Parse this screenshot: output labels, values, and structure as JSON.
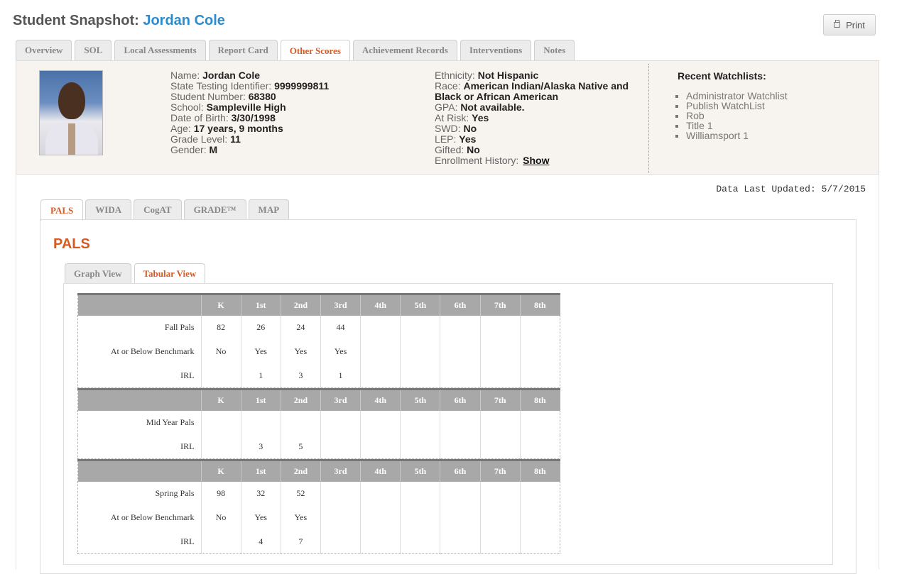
{
  "header": {
    "title_prefix": "Student Snapshot:",
    "student_name": "Jordan Cole",
    "print_label": "Print"
  },
  "main_tabs": [
    {
      "label": "Overview"
    },
    {
      "label": "SOL"
    },
    {
      "label": "Local Assessments"
    },
    {
      "label": "Report Card"
    },
    {
      "label": "Other Scores",
      "active": true
    },
    {
      "label": "Achievement Records"
    },
    {
      "label": "Interventions"
    },
    {
      "label": "Notes"
    }
  ],
  "student": {
    "left": [
      {
        "label": "Name:",
        "value": "Jordan Cole"
      },
      {
        "label": "State Testing Identifier:",
        "value": "9999999811"
      },
      {
        "label": "Student Number:",
        "value": "68380"
      },
      {
        "label": "School:",
        "value": "Sampleville High"
      },
      {
        "label": "Date of Birth:",
        "value": "3/30/1998"
      },
      {
        "label": "Age:",
        "value": "17 years, 9 months"
      },
      {
        "label": "Grade Level:",
        "value": "11"
      },
      {
        "label": "Gender:",
        "value": "M"
      }
    ],
    "right": [
      {
        "label": "Ethnicity:",
        "value": "Not Hispanic"
      },
      {
        "label": "Race:",
        "value": "American Indian/Alaska Native and Black or African American"
      },
      {
        "label": "GPA:",
        "value": "Not available."
      },
      {
        "label": "At Risk:",
        "value": "Yes"
      },
      {
        "label": "SWD:",
        "value": "No"
      },
      {
        "label": "LEP:",
        "value": "Yes"
      },
      {
        "label": "Gifted:",
        "value": "No"
      }
    ],
    "enrollment_label": "Enrollment History:",
    "enrollment_link": "Show"
  },
  "watchlists": {
    "title": "Recent Watchlists:",
    "items": [
      "Administrator Watchlist",
      "Publish WatchList",
      "Rob",
      "Title 1",
      "Williamsport 1"
    ]
  },
  "data_updated": "Data Last Updated: 5/7/2015",
  "score_tabs": [
    {
      "label": "PALS",
      "active": true
    },
    {
      "label": "WIDA"
    },
    {
      "label": "CogAT"
    },
    {
      "label": "GRADE™"
    },
    {
      "label": "MAP"
    }
  ],
  "pals": {
    "title": "PALS",
    "view_tabs": [
      {
        "label": "Graph View"
      },
      {
        "label": "Tabular View",
        "active": true
      }
    ],
    "grades": [
      "K",
      "1st",
      "2nd",
      "3rd",
      "4th",
      "5th",
      "6th",
      "7th",
      "8th"
    ],
    "tables": [
      {
        "id": "t-fall",
        "rows": [
          {
            "label": "Fall Pals",
            "cells": [
              "82",
              "26",
              "24",
              "44",
              "",
              "",
              "",
              "",
              ""
            ]
          },
          {
            "label": "At or Below Benchmark",
            "cells": [
              "No",
              "Yes",
              "Yes",
              "Yes",
              "",
              "",
              "",
              "",
              ""
            ]
          },
          {
            "label": "IRL",
            "cells": [
              "",
              "1",
              "3",
              "1",
              "",
              "",
              "",
              "",
              ""
            ]
          }
        ]
      },
      {
        "id": "t-mid",
        "rows": [
          {
            "label": "Mid Year Pals",
            "cells": [
              "",
              "",
              "",
              "",
              "",
              "",
              "",
              "",
              ""
            ]
          },
          {
            "label": "IRL",
            "cells": [
              "",
              "3",
              "5",
              "",
              "",
              "",
              "",
              "",
              ""
            ]
          }
        ]
      },
      {
        "id": "t-spring",
        "rows": [
          {
            "label": "Spring Pals",
            "cells": [
              "98",
              "32",
              "52",
              "",
              "",
              "",
              "",
              "",
              ""
            ]
          },
          {
            "label": "At or Below Benchmark",
            "cells": [
              "No",
              "Yes",
              "Yes",
              "",
              "",
              "",
              "",
              "",
              ""
            ]
          },
          {
            "label": "IRL",
            "cells": [
              "",
              "4",
              "7",
              "",
              "",
              "",
              "",
              "",
              ""
            ]
          }
        ]
      }
    ]
  }
}
